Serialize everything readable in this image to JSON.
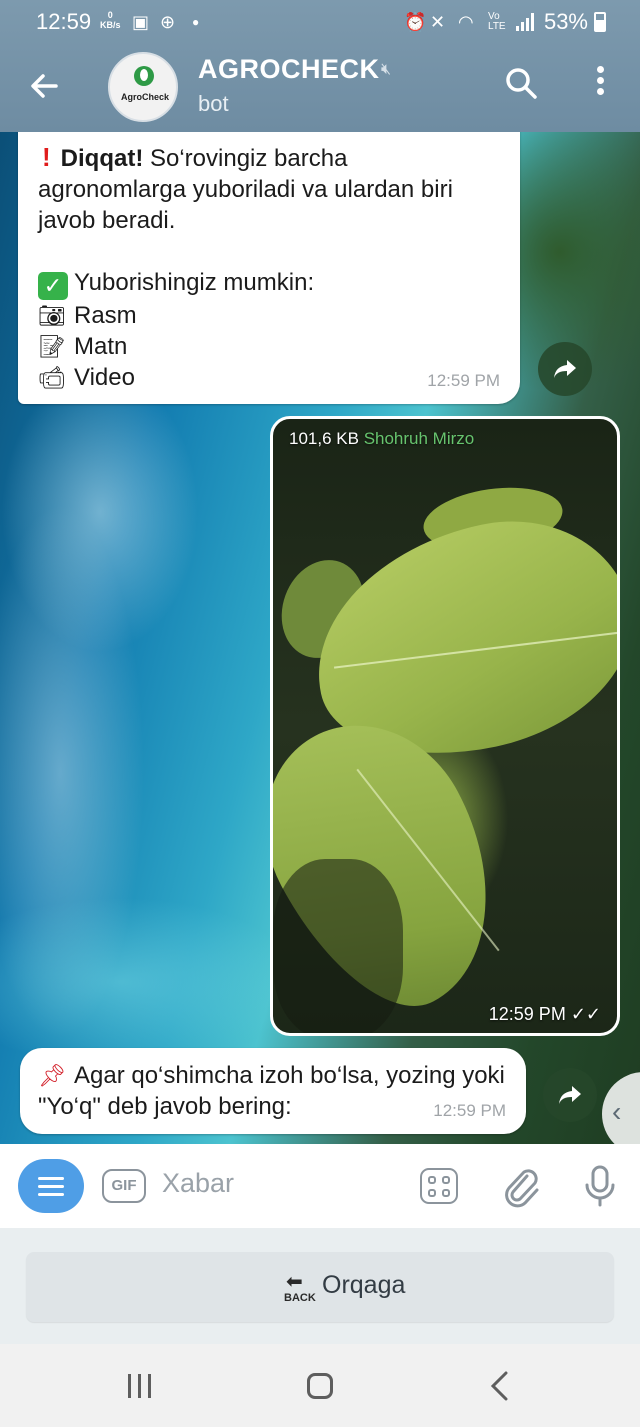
{
  "status_bar": {
    "time": "12:59",
    "net_speed": "0",
    "net_unit": "KB/s",
    "battery": "53%"
  },
  "header": {
    "avatar_text": "AgroCheck",
    "title": "AGROCHECK",
    "subtitle": "bot"
  },
  "messages": {
    "m1": {
      "line1_bold": "Diqqat!",
      "line1_rest": " So‘rovingiz barcha agronomlarga yuboriladi va ulardan biri javob beradi.",
      "heading": "Yuborishingiz mumkin:",
      "items": [
        "Rasm",
        "Matn",
        "Video"
      ],
      "time": "12:59 PM"
    },
    "m2": {
      "size": "101,6 KB",
      "sender": "Shohruh Mirzo",
      "time": "12:59 PM"
    },
    "m3": {
      "text": "Agar qo‘shimcha izoh bo‘lsa, yozing yoki \"Yo‘q\" deb javob bering:",
      "time": "12:59 PM"
    }
  },
  "input": {
    "placeholder": "Xabar",
    "gif_label": "GIF"
  },
  "keyboard": {
    "back_button": "Orqaga",
    "back_icon_text": "BACK"
  }
}
